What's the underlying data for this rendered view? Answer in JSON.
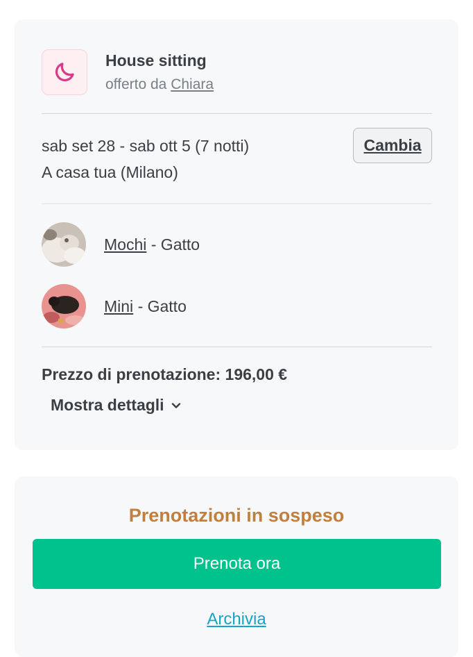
{
  "service": {
    "title": "House sitting",
    "offered_by_prefix": "offerto da",
    "sitter_name": "Chiara",
    "icon": "moon-icon",
    "icon_color": "#d83b86"
  },
  "booking": {
    "dates": "sab set 28 - sab ott 5 (7 notti)",
    "location": "A casa tua (Milano)",
    "change_label": "Cambia"
  },
  "pets": [
    {
      "name": "Mochi",
      "type": "- Gatto"
    },
    {
      "name": "Mini",
      "type": "- Gatto"
    }
  ],
  "price": {
    "label": "Prezzo di prenotazione: 196,00 €"
  },
  "details": {
    "label": "Mostra dettagli",
    "icon": "chevron-down-icon"
  },
  "pending": {
    "title": "Prenotazioni in sospeso",
    "book_label": "Prenota ora",
    "more_label": "Archivia"
  },
  "colors": {
    "accent_green": "#00c28c",
    "pending_orange": "#c17f3e",
    "link_blue": "#16a3c9"
  }
}
